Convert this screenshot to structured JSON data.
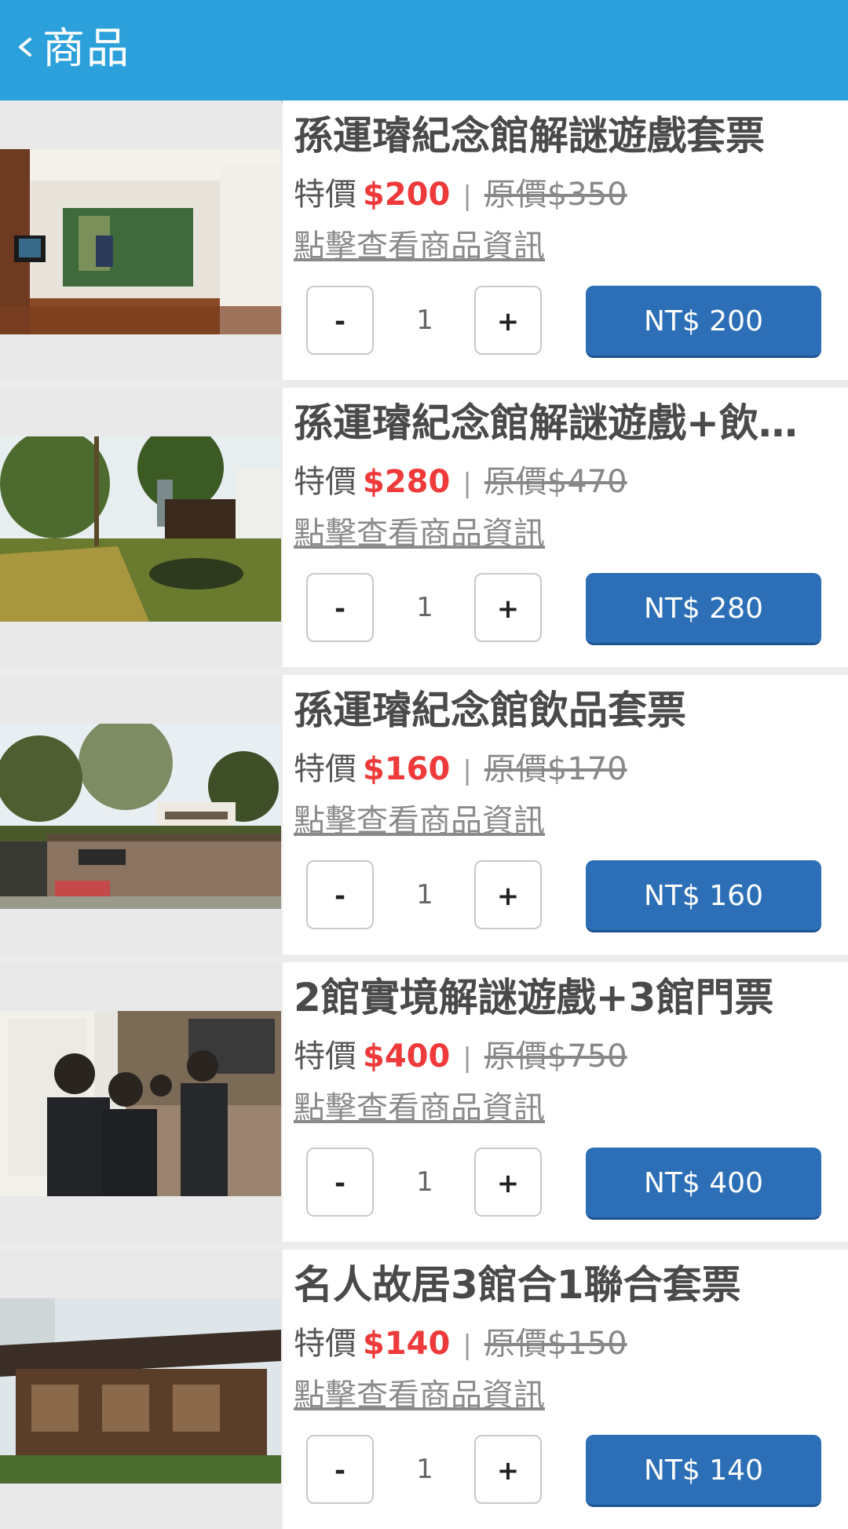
{
  "header": {
    "title": "商品"
  },
  "products": [
    {
      "title": "孫運璿紀念館解謎遊戲套票",
      "special_label": "特價",
      "special_price": "$200",
      "separator": "|",
      "original_price": "原價$350",
      "detail_link": "點擊查看商品資訊",
      "qty_minus": "-",
      "qty": "1",
      "qty_plus": "+",
      "buy_label": "NT$ 200"
    },
    {
      "title": "孫運璿紀念館解謎遊戲+飲品套票",
      "special_label": "特價",
      "special_price": "$280",
      "separator": "|",
      "original_price": "原價$470",
      "detail_link": "點擊查看商品資訊",
      "qty_minus": "-",
      "qty": "1",
      "qty_plus": "+",
      "buy_label": "NT$ 280"
    },
    {
      "title": "孫運璿紀念館飲品套票",
      "special_label": "特價",
      "special_price": "$160",
      "separator": "|",
      "original_price": "原價$170",
      "detail_link": "點擊查看商品資訊",
      "qty_minus": "-",
      "qty": "1",
      "qty_plus": "+",
      "buy_label": "NT$ 160"
    },
    {
      "title": "2館實境解謎遊戲+3館門票",
      "special_label": "特價",
      "special_price": "$400",
      "separator": "|",
      "original_price": "原價$750",
      "detail_link": "點擊查看商品資訊",
      "qty_minus": "-",
      "qty": "1",
      "qty_plus": "+",
      "buy_label": "NT$ 400"
    },
    {
      "title": "名人故居3館合1聯合套票",
      "special_label": "特價",
      "special_price": "$140",
      "separator": "|",
      "original_price": "原價$150",
      "detail_link": "點擊查看商品資訊",
      "qty_minus": "-",
      "qty": "1",
      "qty_plus": "+",
      "buy_label": "NT$ 140"
    }
  ]
}
